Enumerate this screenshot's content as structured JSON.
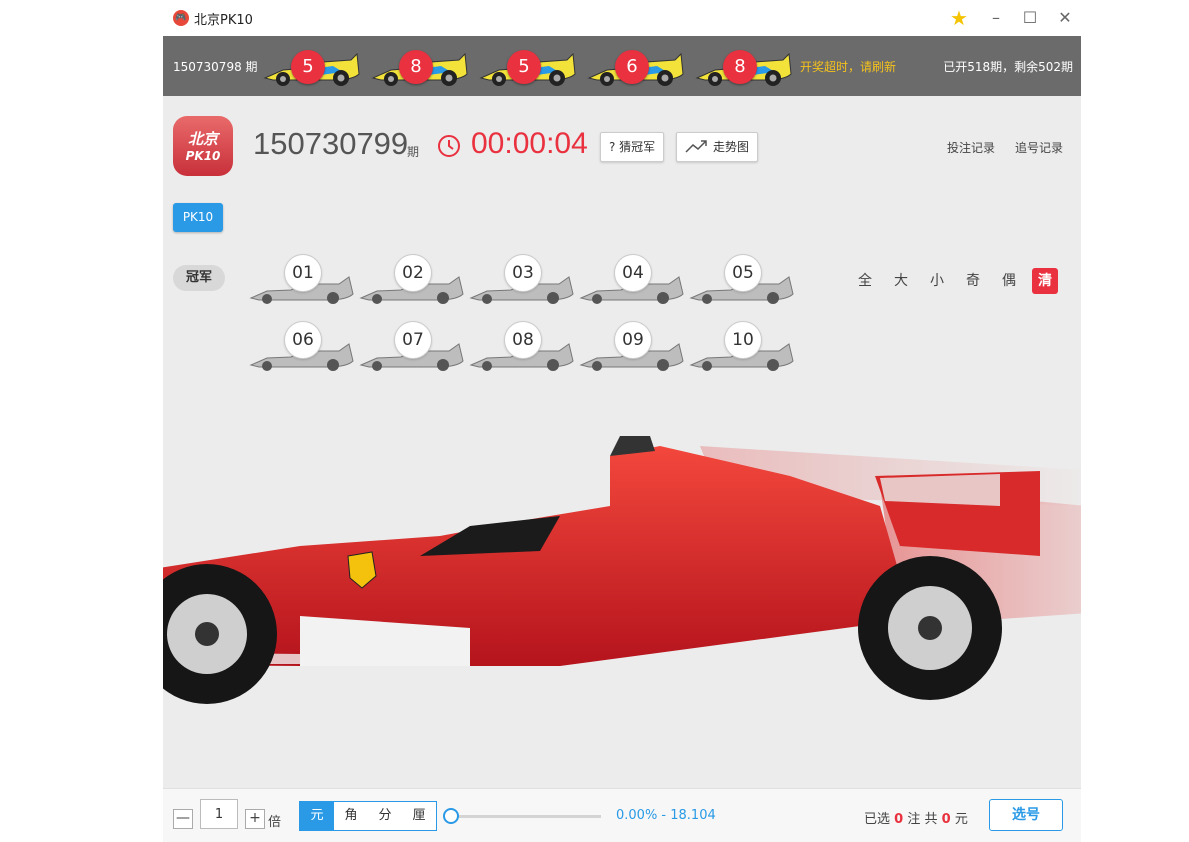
{
  "window": {
    "title": "北京PK10",
    "icon": "gamepad-icon",
    "controls": [
      "star-icon",
      "minimize-icon",
      "maximize-icon",
      "close-icon"
    ]
  },
  "last_draw": {
    "issue": "150730798 期",
    "balls": [
      "5",
      "8",
      "5",
      "6",
      "8"
    ],
    "timeout_text": "开奖超时，请刷新",
    "progress_text": "已开518期，剩余502期"
  },
  "header": {
    "logo_line1": "北京",
    "logo_line2": "PK10",
    "current_issue": "150730799",
    "issue_suffix": "期",
    "countdown": "00:00:04",
    "guess_button": "? 猜冠军",
    "trend_button": "走势图",
    "bet_record": "投注记录",
    "chase_record": "追号记录"
  },
  "tab": {
    "label": "PK10"
  },
  "position": {
    "label": "冠军"
  },
  "numbers": [
    "01",
    "02",
    "03",
    "04",
    "05",
    "06",
    "07",
    "08",
    "09",
    "10"
  ],
  "filters": [
    "全",
    "大",
    "小",
    "奇",
    "偶",
    "清"
  ],
  "bottom": {
    "minus": "—",
    "multiplier": "1",
    "plus": "+",
    "multiplier_unit": "倍",
    "units": [
      "元",
      "角",
      "分",
      "厘"
    ],
    "active_unit": "元",
    "rate": "0.00% - 18.104",
    "selected_prefix": "已选",
    "selected_count": "0",
    "selected_mid": "注  共",
    "total_amount": "0",
    "total_unit": "元",
    "select_button": "选号"
  },
  "colors": {
    "accent": "#2a9ae6",
    "red": "#e9313f",
    "gold": "#f6c21b",
    "bar": "#6b6b6b"
  }
}
